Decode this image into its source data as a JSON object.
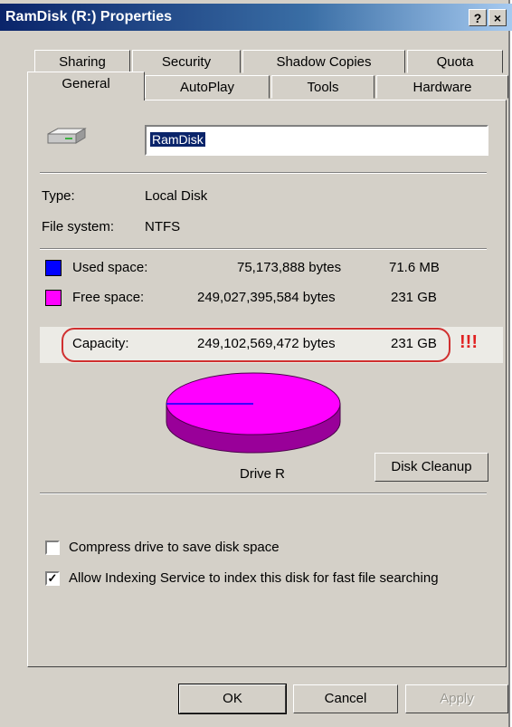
{
  "window": {
    "title": "RamDisk (R:) Properties",
    "help_glyph": "?",
    "close_glyph": "×"
  },
  "tabs": {
    "row1": [
      "Sharing",
      "Security",
      "Shadow Copies",
      "Quota"
    ],
    "row2": [
      "General",
      "AutoPlay",
      "Tools",
      "Hardware"
    ],
    "active": "General"
  },
  "volume": {
    "name": "RamDisk"
  },
  "info": {
    "type_label": "Type:",
    "type_value": "Local Disk",
    "fs_label": "File system:",
    "fs_value": "NTFS"
  },
  "space": {
    "used": {
      "label": "Used space:",
      "bytes": "75,173,888 bytes",
      "size": "71.6 MB",
      "color": "#0000ff"
    },
    "free": {
      "label": "Free space:",
      "bytes": "249,027,395,584 bytes",
      "size": "231 GB",
      "color": "#ff00ff"
    },
    "capacity": {
      "label": "Capacity:",
      "bytes": "249,102,569,472 bytes",
      "size": "231 GB"
    },
    "annotation": "!!!"
  },
  "chart_data": {
    "type": "pie",
    "categories": [
      "Used space",
      "Free space"
    ],
    "values": [
      75173888,
      249027395584
    ],
    "colors": [
      "#0000ff",
      "#ff00ff"
    ],
    "title": "Drive R"
  },
  "buttons": {
    "disk_cleanup": "Disk Cleanup",
    "ok": "OK",
    "cancel": "Cancel",
    "apply": "Apply"
  },
  "options": {
    "compress": {
      "label": "Compress drive to save disk space",
      "checked": false
    },
    "indexing": {
      "label": "Allow Indexing Service to index this disk for fast file searching",
      "checked": true
    }
  }
}
